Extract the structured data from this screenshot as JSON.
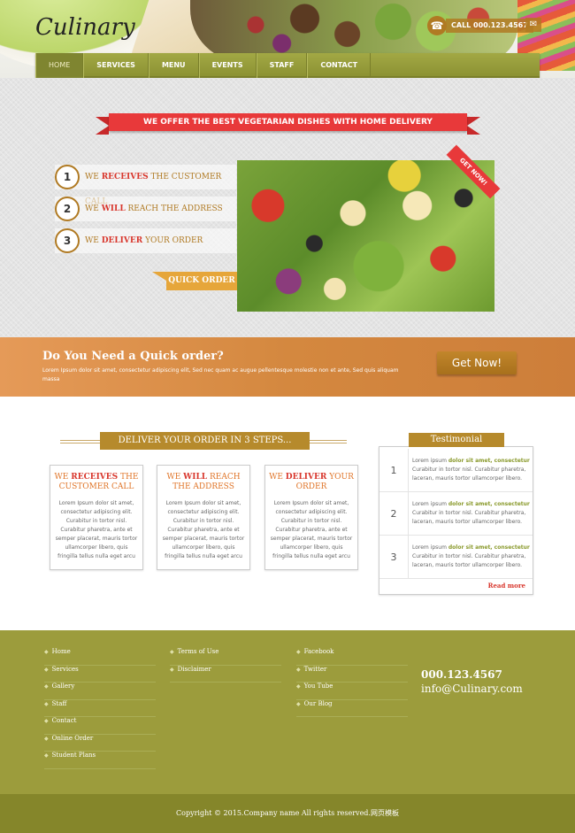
{
  "header": {
    "logo": "Culinary",
    "phone": "CALL 000.123.4567"
  },
  "nav": [
    "HOME",
    "SERVICES",
    "MENU",
    "EVENTS",
    "STAFF",
    "CONTACT"
  ],
  "hero": {
    "ribbon": "WE OFFER THE BEST VEGETARIAN DISHES WITH HOME DELIVERY",
    "steps": [
      {
        "num": "1",
        "pre": "WE ",
        "bold": "RECEIVES",
        "post": " THE CUSTOMER CALL"
      },
      {
        "num": "2",
        "pre": "WE ",
        "bold": "WILL",
        "post": " REACH THE ADDRESS"
      },
      {
        "num": "3",
        "pre": "WE ",
        "bold": "DELIVER",
        "post": " YOUR ORDER"
      }
    ],
    "quick_order": "QUICK ORDER",
    "get_now_tag": "GET NOW!"
  },
  "band": {
    "title": "Do You Need a Quick order?",
    "text": "Lorem Ipsum dolor sit amet, consectetur adipiscing elit, Sed nec quam ac augue pellentesque molestie non et ante, Sed quis aliquam massa",
    "button": "Get Now!"
  },
  "steps_section": {
    "title": "DELIVER YOUR ORDER IN 3 STEPS...",
    "boxes": [
      {
        "pre": "WE ",
        "bold": "RECEIVES",
        "post": " THE CUSTOMER CALL",
        "text": "Lorem Ipsum dolor sit amet, consectetur adipiscing elit. Curabitur in tortor nisl. Curabitur pharetra, ante et semper placerat, mauris tortor ullamcorper libero, quis fringilla tellus nulla eget arcu"
      },
      {
        "pre": "WE ",
        "bold": "WILL",
        "post": " REACH THE ADDRESS",
        "text": "Lorem Ipsum dolor sit amet, consectetur adipiscing elit. Curabitur in tortor nisl. Curabitur pharetra, ante et semper placerat, mauris tortor ullamcorper libero, quis fringilla tellus nulla eget arcu"
      },
      {
        "pre": "WE ",
        "bold": "DELIVER",
        "post": " YOUR ORDER",
        "text": "Lorem Ipsum dolor sit amet, consectetur adipiscing elit. Curabitur in tortor nisl. Curabitur pharetra, ante et semper placerat, mauris tortor ullamcorper libero, quis fringilla tellus nulla eget arcu"
      }
    ]
  },
  "testimonial": {
    "title": "Testimonial",
    "items": [
      {
        "num": "1",
        "lead": "Lorem ipsum ",
        "bold": "dolor sit amet, consectetur",
        "text": " Curabitur in tortor nisl. Curabitur pharetra, laceran, mauris tortor ullamcorper libero."
      },
      {
        "num": "2",
        "lead": "Lorem ipsum ",
        "bold": "dolor sit amet, consectetur",
        "text": " Curabitur in tortor nisl. Curabitur pharetra, laceran, mauris tortor ullamcorper libero."
      },
      {
        "num": "3",
        "lead": "Lorem ipsum ",
        "bold": "dolor sit amet, consectetur",
        "text": " Curabitur in tortor nisl. Curabitur pharetra, laceran, mauris tortor ullamcorper libero."
      }
    ],
    "read_more": "Read more"
  },
  "footer": {
    "col1": [
      "Home",
      "Services",
      "Gallery",
      "Staff",
      "Contact",
      "Online Order",
      "Student Plans"
    ],
    "col2": [
      "Terms of Use",
      "Disclaimer"
    ],
    "col3": [
      "Facebook",
      "Twitter",
      "You Tube",
      "Our Blog"
    ],
    "phone": "000.123.4567",
    "email": "info@Culinary.com",
    "copyright": "Copyright © 2015.Company name All rights reserved.网页模板"
  },
  "colors": {
    "olive": "#9c9c3c",
    "orange": "#d4883f",
    "red": "#e8393a",
    "gold": "#b68a2c"
  }
}
